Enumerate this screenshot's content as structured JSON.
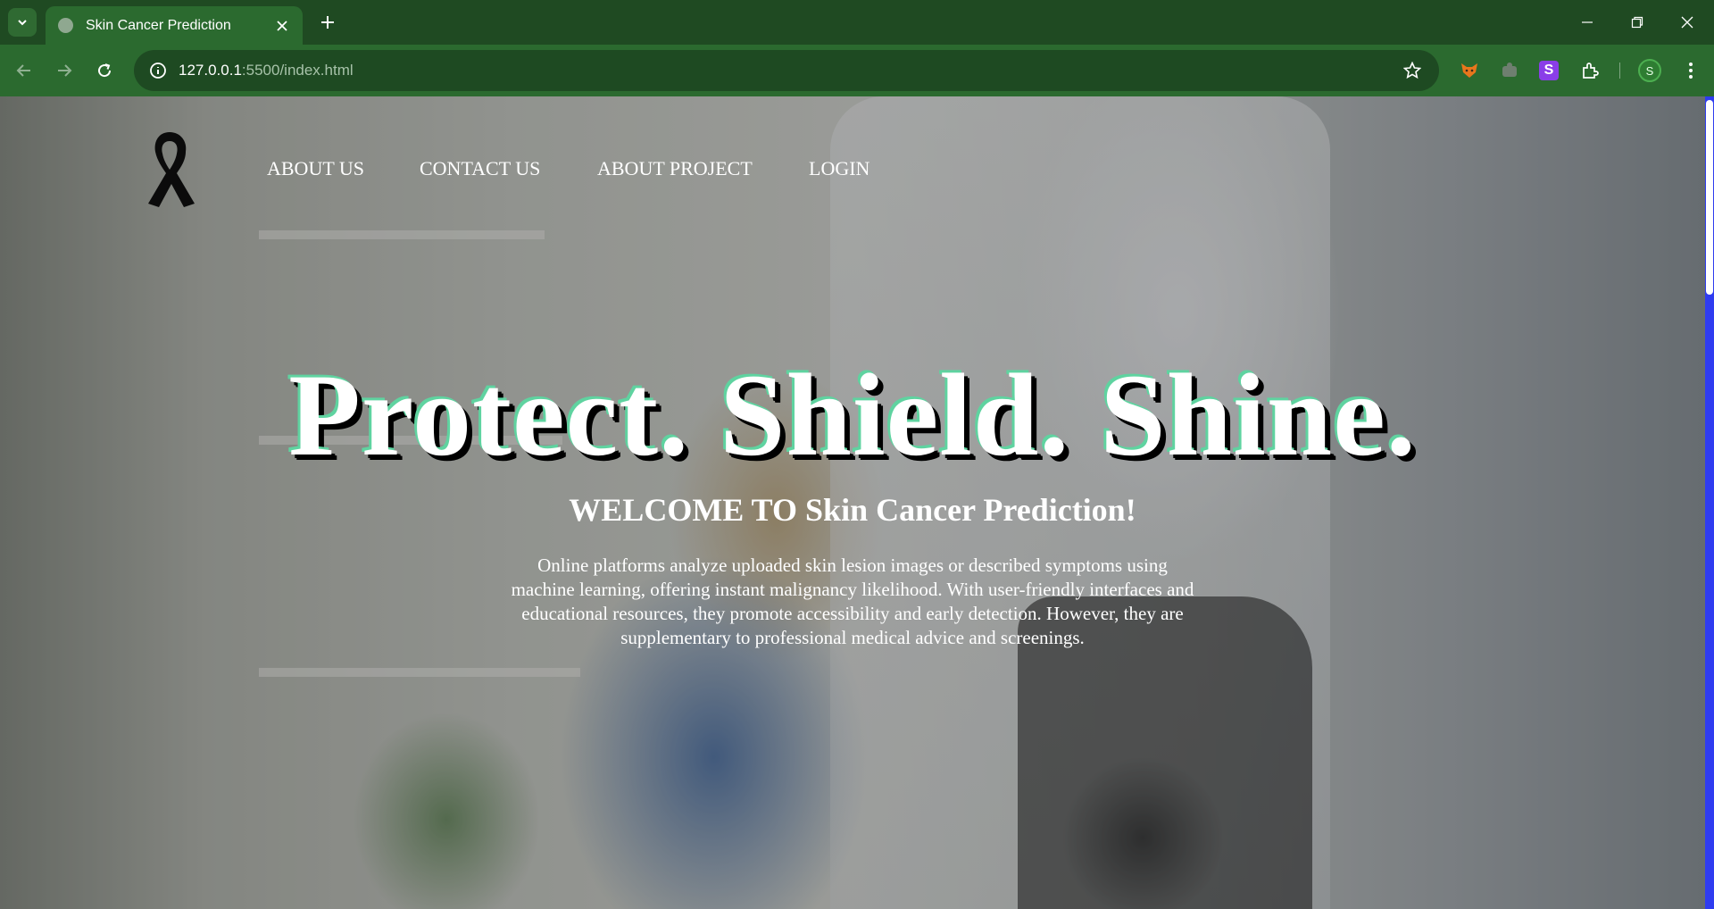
{
  "browser": {
    "tab_title": "Skin Cancer Prediction",
    "url_host": "127.0.0.1",
    "url_path": ":5500/index.html",
    "profile_initial": "S",
    "extension_s_label": "S",
    "theme_color": "#2b6a2f"
  },
  "nav": {
    "items": [
      "ABOUT US",
      "CONTACT US",
      "ABOUT PROJECT",
      "LOGIN"
    ]
  },
  "hero": {
    "title": "Protect. Shield. Shine.",
    "welcome": "WELCOME TO Skin Cancer Prediction!",
    "intro": "Online platforms analyze uploaded skin lesion images or described symptoms using machine learning, offering instant malignancy likelihood. With user-friendly interfaces and educational resources, they promote accessibility and early detection. However, they are supplementary to professional medical advice and screenings."
  },
  "icons": {
    "logo": "awareness-ribbon-icon",
    "scrollbar_color": "#2f3cf0"
  }
}
